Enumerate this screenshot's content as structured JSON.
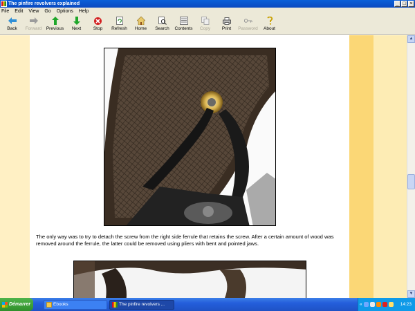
{
  "window": {
    "title": "The pinfire revolvers explained",
    "controls": [
      "_",
      "□",
      "×"
    ]
  },
  "menu": {
    "items": [
      "File",
      "Edit",
      "View",
      "Go",
      "Options",
      "Help"
    ]
  },
  "toolbar": {
    "buttons": [
      {
        "label": "Back",
        "icon": "back-arrow-icon",
        "enabled": true
      },
      {
        "label": "Forward",
        "icon": "forward-arrow-icon",
        "enabled": false
      },
      {
        "label": "Previous",
        "icon": "up-arrow-icon",
        "enabled": true
      },
      {
        "label": "Next",
        "icon": "down-arrow-icon",
        "enabled": true
      },
      {
        "label": "Stop",
        "icon": "stop-icon",
        "enabled": true
      },
      {
        "label": "Refresh",
        "icon": "refresh-icon",
        "enabled": true
      },
      {
        "label": "Home",
        "icon": "home-icon",
        "enabled": true
      },
      {
        "label": "Search",
        "icon": "search-icon",
        "enabled": true
      },
      {
        "label": "Contents",
        "icon": "contents-icon",
        "enabled": true
      },
      {
        "label": "Copy",
        "icon": "copy-icon",
        "enabled": false
      },
      {
        "label": "Print",
        "icon": "print-icon",
        "enabled": true
      },
      {
        "label": "Password",
        "icon": "key-icon",
        "enabled": false
      },
      {
        "label": "About",
        "icon": "about-icon",
        "enabled": true
      }
    ]
  },
  "content": {
    "caption": "The only way was to try to detach the screw from the right side ferrule that retains the screw. After a certain amount of wood was removed around the ferrule, the latter could be removed using pliers with bent and pointed jaws."
  },
  "taskbar": {
    "start_label": "Démarrer",
    "tasks": [
      {
        "label": "Ebooks",
        "active": false
      },
      {
        "label": "The pinfire revolvers ...",
        "active": true
      }
    ],
    "tray_expand": "«",
    "clock": "14:23"
  },
  "colors": {
    "page_background": "#fff0c4",
    "stripe_dark": "#fbd776",
    "stripe_light": "#fdecb4",
    "titlebar": "#0a5fd8",
    "toolbar": "#ece9d8"
  }
}
